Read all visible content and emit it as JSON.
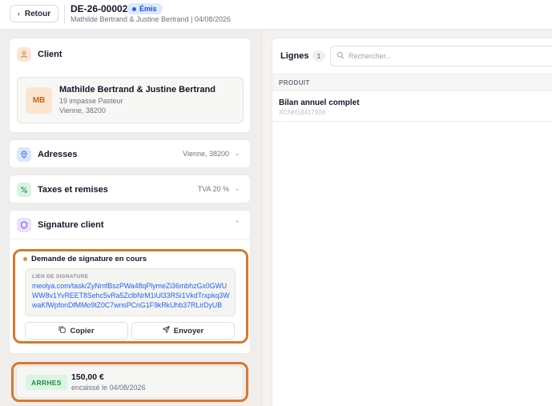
{
  "header": {
    "back_label": "Retour",
    "doc_ref": "DE-26-00002",
    "status": "Émis",
    "subtitle": "Mathilde Bertrand & Justine Bertrand | 04/08/2026"
  },
  "client": {
    "section_title": "Client",
    "initials": "MB",
    "name": "Mathilde Bertrand & Justine Bertrand",
    "address": "19 impasse Pasteur",
    "city_line": "Vienne, 38200"
  },
  "addresses": {
    "title": "Adresses",
    "value": "Vienne, 38200"
  },
  "taxes": {
    "title": "Taxes et remises",
    "value": "TVA 20 %"
  },
  "signature": {
    "title": "Signature client",
    "pending_label": "Demande de signature en cours",
    "link_label": "LIEN DE SIGNATURE",
    "link": "meolya.com/task/ZyNmfBszPWa48qPlymeZi36mbhzGx0GWUWW8v1YvREET8Sehc5vRa5ZclbNrM1iUl33RSi1VkdTrxpkq3WwaKfWpfonDfMMo9tZ0C7wnsPCnG1F9kRkUhb37RLirDyUB",
    "copy_label": "Copier",
    "send_label": "Envoyer"
  },
  "arrhes": {
    "badge": "ARRHES",
    "amount": "150,00 €",
    "caption": "encaissé le 04/08/2026"
  },
  "lines": {
    "title": "Lignes",
    "count": "1",
    "search_placeholder": "Rechercher...",
    "column_product": "PRODUIT",
    "rows": [
      {
        "name": "Bilan annuel complet",
        "ref": "XCNH18417926"
      }
    ]
  },
  "colors": {
    "accent_orange": "#d9782c",
    "status_blue": "#1d4ed8",
    "success_green": "#1e8a45",
    "link_blue": "#2563eb"
  }
}
